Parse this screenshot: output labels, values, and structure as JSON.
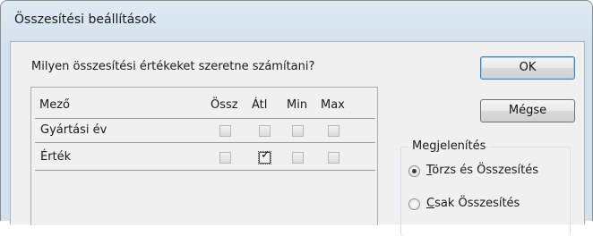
{
  "window": {
    "title": "Összesítési beállítások"
  },
  "prompt": "Milyen összesítési értékeket szeretne számítani?",
  "grid": {
    "field_header": "Mező",
    "columns": [
      "Össz",
      "Átl",
      "Min",
      "Max"
    ],
    "rows": [
      {
        "label": "Gyártási év",
        "checked": [
          false,
          false,
          false,
          false
        ]
      },
      {
        "label": "Érték",
        "checked": [
          false,
          true,
          false,
          false
        ]
      }
    ]
  },
  "buttons": {
    "ok": "OK",
    "cancel": "Mégse"
  },
  "display_group": {
    "legend": "Megjelenítés",
    "options": [
      {
        "label": "Törzs és Összesítés",
        "selected": true
      },
      {
        "label": "Csak Összesítés",
        "selected": false
      }
    ]
  }
}
